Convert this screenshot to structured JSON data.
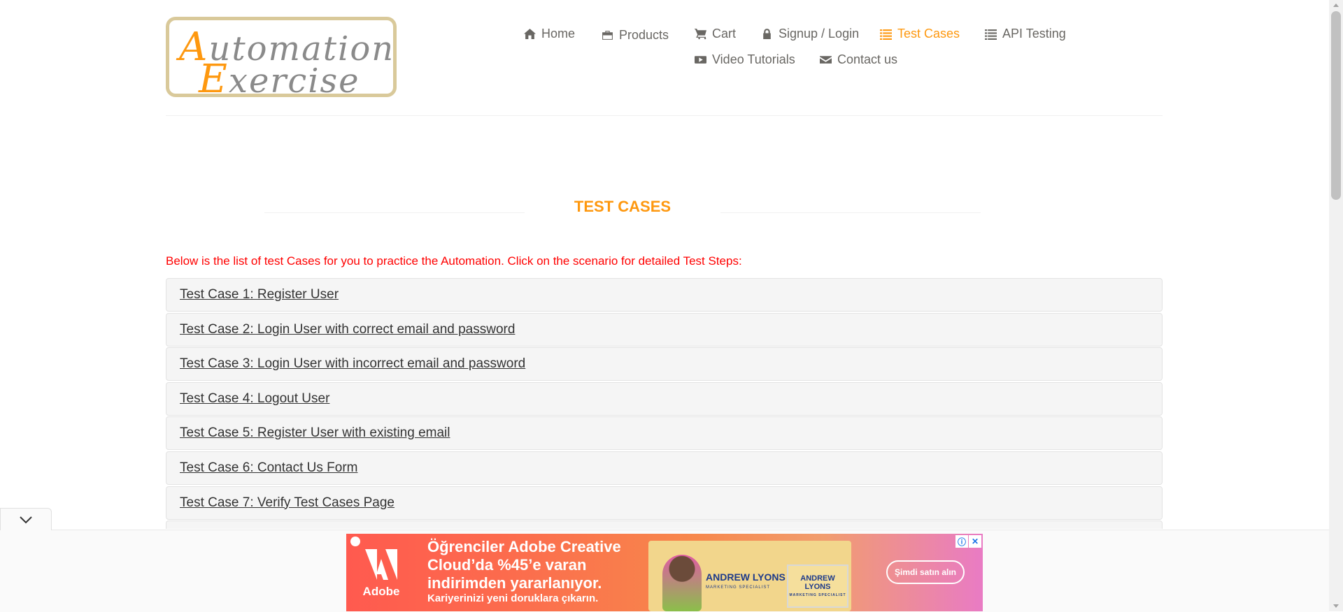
{
  "logo": {
    "line1_first": "A",
    "line1_rest": "utomation",
    "line2_first": "E",
    "line2_rest": "xercise"
  },
  "nav": {
    "items": [
      {
        "label": "Home",
        "icon": "home-icon"
      },
      {
        "label": "Products",
        "icon": "briefcase-icon"
      },
      {
        "label": "Cart",
        "icon": "cart-icon"
      },
      {
        "label": "Signup / Login",
        "icon": "lock-icon"
      },
      {
        "label": "Test Cases",
        "icon": "list-icon",
        "active": true
      },
      {
        "label": "API Testing",
        "icon": "list-icon"
      },
      {
        "label": "Video Tutorials",
        "icon": "youtube-play-icon"
      },
      {
        "label": "Contact us",
        "icon": "envelope-icon"
      }
    ]
  },
  "page": {
    "title": "TEST CASES",
    "intro": "Below is the list of test Cases for you to practice the Automation. Click on the scenario for detailed Test Steps:"
  },
  "test_cases": [
    "Test Case 1: Register User",
    "Test Case 2: Login User with correct email and password",
    "Test Case 3: Login User with incorrect email and password",
    "Test Case 4: Logout User",
    "Test Case 5: Register User with existing email",
    "Test Case 6: Contact Us Form",
    "Test Case 7: Verify Test Cases Page"
  ],
  "ad": {
    "brand": "Adobe",
    "headline": "Öğrenciler Adobe Creative Cloud’da %45’e varan indirimden yararlanıyor.",
    "sub": "Kariyerinizi yeni doruklara çıkarın.",
    "name_a": "ANDREW LYONS",
    "name_a_role": "MARKETING SPECIALIST",
    "name_b": "ANDREW LYONS",
    "name_b_role": "MARKETING SPECIALIST",
    "cta": "Şimdi satın alın",
    "info_glyph": "ⓘ",
    "close_glyph": "✕"
  },
  "colors": {
    "accent": "#fe980f",
    "intro_text": "#ff0000",
    "nav_text": "#696763"
  }
}
